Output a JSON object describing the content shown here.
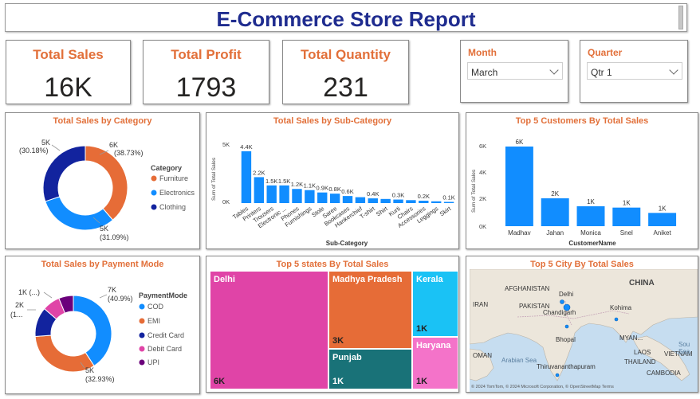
{
  "header": {
    "title": "E-Commerce Store Report"
  },
  "kpis": [
    {
      "label": "Total Sales",
      "value": "16K"
    },
    {
      "label": "Total Profit",
      "value": "1793"
    },
    {
      "label": "Total Quantity",
      "value": "231"
    }
  ],
  "slicers": {
    "month": {
      "label": "Month",
      "value": "March"
    },
    "quarter": {
      "label": "Quarter",
      "value": "Qtr 1"
    }
  },
  "category_chart": {
    "title": "Total Sales by Category",
    "legend_title": "Category",
    "slices": [
      {
        "name": "Furniture",
        "value": 6,
        "pct": 38.73,
        "label": "6K",
        "pct_label": "(38.73%)",
        "color": "#e66c37"
      },
      {
        "name": "Electronics",
        "value": 5,
        "pct": 31.09,
        "label": "5K",
        "pct_label": "(31.09%)",
        "color": "#118dff"
      },
      {
        "name": "Clothing",
        "value": 5,
        "pct": 30.18,
        "label": "5K",
        "pct_label": "(30.18%)",
        "color": "#12239e"
      }
    ]
  },
  "subcategory_chart": {
    "title": "Total Sales by Sub-Category",
    "xlabel": "Sub-Category",
    "ylabel": "Sum of Total Sales",
    "yticks": [
      "5K",
      "0K"
    ],
    "categories": [
      "Tables",
      "Printers",
      "Trousers",
      "Electronic ...",
      "Phones",
      "Furnishings",
      "Stole",
      "Saree",
      "Bookcases",
      "Hankerchief",
      "T-shirt",
      "Shirt",
      "Kurti",
      "Chairs",
      "Accessories",
      "Leggings",
      "Skirt"
    ],
    "values": [
      4.4,
      2.2,
      1.5,
      1.5,
      1.2,
      1.1,
      0.9,
      0.8,
      0.6,
      0.5,
      0.4,
      0.35,
      0.3,
      0.25,
      0.2,
      0.15,
      0.1
    ],
    "data_labels": [
      "4.4K",
      "2.2K",
      "1.5K",
      "1.5K",
      "1.2K",
      "1.1K",
      "0.9K",
      "0.8K",
      "0.6K",
      "",
      "0.4K",
      "",
      "0.3K",
      "",
      "0.2K",
      "",
      "0.1K"
    ],
    "color": "#118dff"
  },
  "customers_chart": {
    "title": "Top 5 Customers By Total Sales",
    "xlabel": "CustomerName",
    "ylabel": "Sum of Total Sales",
    "yticks": [
      "6K",
      "4K",
      "2K",
      "0K"
    ],
    "categories": [
      "Madhav",
      "Jahan",
      "Monica",
      "Snel",
      "Aniket"
    ],
    "values": [
      6.0,
      2.1,
      1.5,
      1.4,
      1.0
    ],
    "data_labels": [
      "6K",
      "2K",
      "1K",
      "1K",
      "1K"
    ],
    "color": "#118dff"
  },
  "payment_chart": {
    "title": "Total Sales by Payment Mode",
    "legend_title": "PaymentMode",
    "slices": [
      {
        "name": "COD",
        "pct": 40.9,
        "label": "7K",
        "pct_label": "(40.9%)",
        "color": "#118dff"
      },
      {
        "name": "EMI",
        "pct": 32.93,
        "label": "5K",
        "pct_label": "(32.93%)",
        "color": "#e66c37"
      },
      {
        "name": "Credit Card",
        "pct": 12.5,
        "label": "2K",
        "pct_label": "(1...",
        "color": "#12239e"
      },
      {
        "name": "Debit Card",
        "pct": 7.5,
        "label": "1K (...)",
        "pct_label": "",
        "color": "#e044a7"
      },
      {
        "name": "UPI",
        "pct": 6.17,
        "label": "",
        "pct_label": "",
        "color": "#6b007b"
      }
    ]
  },
  "states_chart": {
    "title": "Top 5 states By Total Sales",
    "items": [
      {
        "name": "Delhi",
        "label": "6K",
        "color": "#e044a7"
      },
      {
        "name": "Madhya Pradesh",
        "label": "3K",
        "color": "#e66c37"
      },
      {
        "name": "Kerala",
        "label": "1K",
        "color": "#1ac2f5"
      },
      {
        "name": "Punjab",
        "label": "1K",
        "color": "#197278"
      },
      {
        "name": "Haryana",
        "label": "1K",
        "color": "#f473c9"
      }
    ]
  },
  "city_chart": {
    "title": "Top 5 City By Total Sales",
    "map_labels": {
      "china": "CHINA",
      "afghanistan": "AFGHANISTAN",
      "pakistan": "PAKISTAN",
      "iran": "IRAN",
      "oman": "OMAN",
      "delhi": "Delhi",
      "chandigarh": "Chandigarh",
      "kohima": "Kohima",
      "bhopal": "Bhopal",
      "thiruvananthapuram": "Thiruvananthapuram",
      "arabian_sea": "Arabian Sea",
      "myanmar": "MYAN...",
      "thailand": "THAILAND",
      "vietnam": "VIETNAM",
      "cambodia": "CAMBODIA",
      "laos": "LAOS",
      "south_sea": "Sou Sea",
      "copyright": "© 2024 TomTom, © 2024 Microsoft Corporation, © OpenStreetMap Terms"
    }
  },
  "colors": {
    "accent": "#e2703a",
    "title": "#1f2c8f",
    "bar": "#118dff"
  }
}
